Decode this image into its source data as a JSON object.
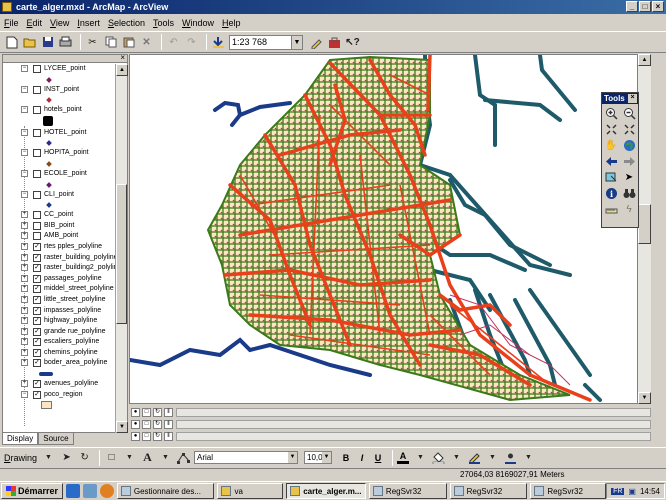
{
  "window": {
    "title": "carte_alger.mxd - ArcMap - ArcView",
    "buttons": [
      "_",
      "□",
      "×"
    ]
  },
  "menu": [
    "File",
    "Edit",
    "View",
    "Insert",
    "Selection",
    "Tools",
    "Window",
    "Help"
  ],
  "toolbar": {
    "scale": "1:23 768"
  },
  "toc": {
    "layers": [
      {
        "name": "LYCEE_point",
        "checked": false,
        "symbol": "dot",
        "color": "#7b1e5a"
      },
      {
        "name": "INST_point",
        "checked": false,
        "symbol": "dot",
        "color": "#b0303a"
      },
      {
        "name": "hotels_point",
        "checked": false,
        "symbol": "square",
        "color": "#000000"
      },
      {
        "name": "HOTEL_point",
        "checked": false,
        "symbol": "dot",
        "color": "#2a2a8a"
      },
      {
        "name": "HOPITA_point",
        "checked": false,
        "symbol": "dot",
        "color": "#8a4a1a"
      },
      {
        "name": "ECOLE_point",
        "checked": false,
        "symbol": "dot",
        "color": "#6a1a6a"
      },
      {
        "name": "CLI_point",
        "checked": false,
        "symbol": "dot",
        "color": "#1a3b8a"
      }
    ],
    "collapsed_layers": [
      {
        "name": "CC_point",
        "checked": false
      },
      {
        "name": "BIB_point",
        "checked": false
      },
      {
        "name": "AMB_point",
        "checked": false
      },
      {
        "name": "rtes pples_polyline",
        "checked": true
      },
      {
        "name": "raster_building_polyline",
        "checked": true
      },
      {
        "name": "raster_building2_polyline",
        "checked": true
      },
      {
        "name": "passages_polyline",
        "checked": true
      },
      {
        "name": "middel_street_polyline",
        "checked": true
      },
      {
        "name": "little_street_polyline",
        "checked": true
      },
      {
        "name": "impasses_polyline",
        "checked": true
      },
      {
        "name": "highway_polyline",
        "checked": true
      },
      {
        "name": "grande rue_polyline",
        "checked": true
      },
      {
        "name": "escaliers_polyline",
        "checked": true
      },
      {
        "name": "chemins_polyline",
        "checked": true
      },
      {
        "name": "boder_area_polyline",
        "checked": true
      }
    ],
    "tail_layers": [
      {
        "name": "avenues_polyline",
        "checked": true
      },
      {
        "name": "poco_region",
        "checked": true
      }
    ],
    "tabs": [
      "Display",
      "Source"
    ]
  },
  "tools_palette": {
    "title": "Tools",
    "tools": [
      "zoom-in",
      "zoom-out",
      "fixed-zoom-in",
      "fixed-zoom-out",
      "pan",
      "full-extent",
      "back",
      "forward",
      "select-features",
      "select-elements",
      "identify",
      "find",
      "measure",
      "hyperlink"
    ]
  },
  "drawing": {
    "label": "Drawing",
    "font": "Arial",
    "size": "10,0",
    "bold": "B",
    "italic": "I",
    "underline": "U",
    "font_color_label": "A"
  },
  "status": {
    "coords": "27064,03  8169027,91 Meters"
  },
  "taskbar": {
    "start": "Démarrer",
    "tasks": [
      {
        "label": "Gestionnaire des...",
        "active": false
      },
      {
        "label": "va",
        "active": false
      },
      {
        "label": "carte_alger.m...",
        "active": true
      },
      {
        "label": "RegSvr32",
        "active": false
      },
      {
        "label": "RegSvr32",
        "active": false
      },
      {
        "label": "RegSvr32",
        "active": false
      }
    ],
    "lang": "FR",
    "clock": "14:54"
  },
  "colors": {
    "streets_red": "#e8401a",
    "buildings_green": "#3a7a1a",
    "land": "#fbe6c0",
    "coast": "#1a3b8a",
    "piers": "#1e5a6a"
  }
}
